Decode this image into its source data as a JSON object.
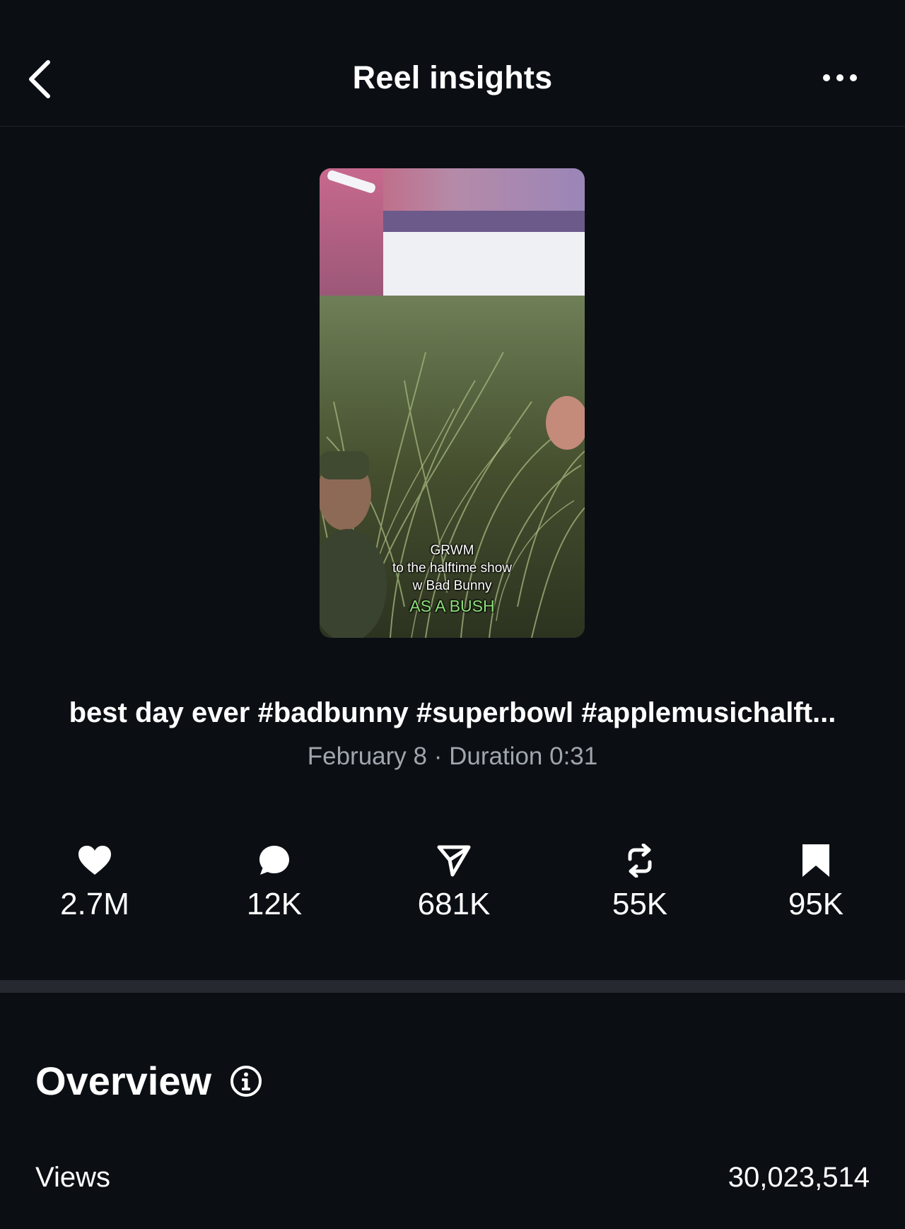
{
  "header": {
    "title": "Reel insights",
    "back_icon": "chevron-left-icon",
    "more_icon": "more-horizontal-icon"
  },
  "thumbnail": {
    "caption_lines": [
      "GRWM",
      "to the halftime show",
      "w Bad Bunny"
    ],
    "caption_accent": "AS A BUSH"
  },
  "reel": {
    "caption": "best day ever #badbunny #superbowl #applemusichalft...",
    "meta": "February 8 · Duration 0:31"
  },
  "stats": [
    {
      "icon": "heart-icon",
      "value": "2.7M"
    },
    {
      "icon": "comment-icon",
      "value": "12K"
    },
    {
      "icon": "share-icon",
      "value": "681K"
    },
    {
      "icon": "repost-icon",
      "value": "55K"
    },
    {
      "icon": "bookmark-icon",
      "value": "95K"
    }
  ],
  "overview": {
    "title": "Overview",
    "info_icon": "info-icon",
    "rows": [
      {
        "label": "Views",
        "value": "30,023,514"
      }
    ]
  },
  "colors": {
    "background": "#0b0f14",
    "text_primary": "#ffffff",
    "text_secondary": "#a0a6ad",
    "divider": "#262a30"
  }
}
